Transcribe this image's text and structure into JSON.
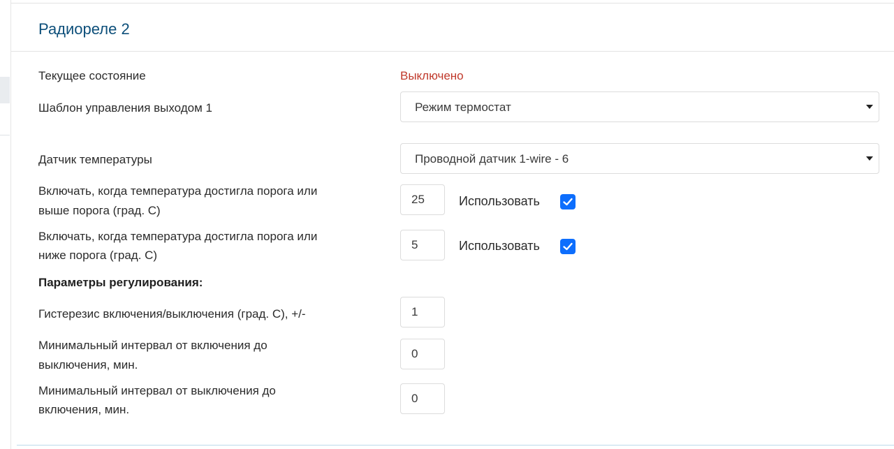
{
  "card": {
    "title": "Радиореле 2"
  },
  "rows": {
    "current_state": {
      "label": "Текущее состояние",
      "value": "Выключено",
      "value_color": "#c0392b"
    },
    "output_template": {
      "label": "Шаблон управления выходом 1",
      "selected": "Режим термостат"
    },
    "temp_sensor": {
      "label": "Датчик температуры",
      "selected": "Проводной датчик 1-wire - 6"
    },
    "on_above": {
      "label_line1": "Включать, когда температура достигла порога или",
      "label_line2": "выше порога (град. С)",
      "value": "25",
      "use_label": "Использовать",
      "use_checked": true
    },
    "on_below": {
      "label_line1": "Включать, когда температура достигла порога или",
      "label_line2": "ниже порога (град. С)",
      "value": "5",
      "use_label": "Использовать",
      "use_checked": true
    },
    "regulation_heading": "Параметры регулирования:",
    "hysteresis": {
      "label": "Гистерезис включения/выключения (град. С), +/-",
      "value": "1"
    },
    "min_on_off": {
      "label_line1": "Минимальный интервал от включения до",
      "label_line2": "выключения, мин.",
      "value": "0"
    },
    "min_off_on": {
      "label_line1": "Минимальный интервал от выключения до",
      "label_line2": "включения, мин.",
      "value": "0"
    }
  },
  "colors": {
    "title": "#0d4f7a",
    "checkbox": "#0d6efd",
    "status_off": "#c0392b"
  },
  "icons": {
    "select_arrow": "caret-down-icon",
    "checkbox_mark": "checkmark-icon"
  }
}
